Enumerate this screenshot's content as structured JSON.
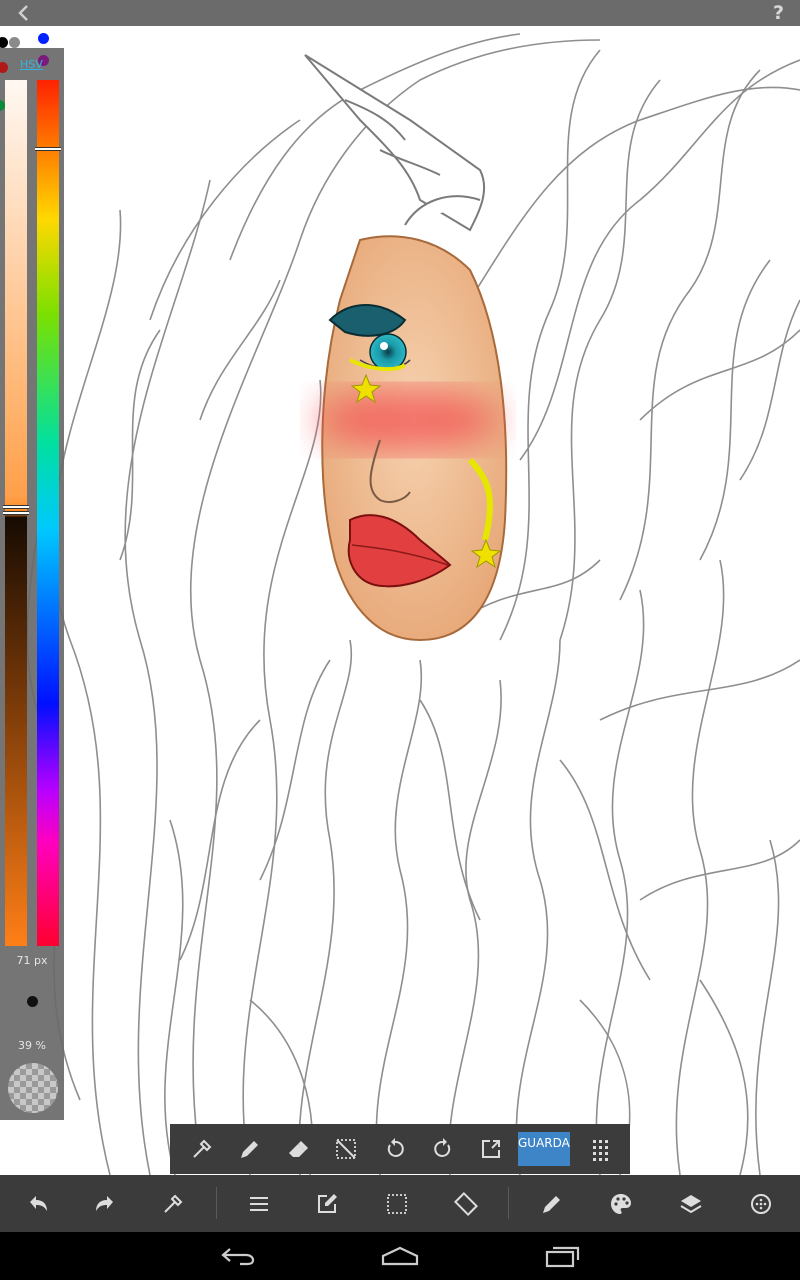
{
  "app": {
    "back_icon": "chevron-left-icon",
    "help_label": "?"
  },
  "color_panel": {
    "mode_label": "HSV",
    "recent_colors": [
      "#000000",
      "#8a8a8a",
      "#0022ff",
      "#b01818",
      "#7a1a7a",
      "#0a8a3a"
    ],
    "current_color": "#ff7f17",
    "brush_size_label": "71 px",
    "opacity_label": "39 %",
    "opacity_value": 0.39
  },
  "sub_toolbar": {
    "icons": [
      "eyedropper-icon",
      "pencil-icon",
      "eraser-icon",
      "deselect-icon",
      "rotate-left-icon",
      "rotate-right-icon",
      "export-icon"
    ],
    "save_label": "GUARDAR",
    "more_icon": "grid-dots-icon"
  },
  "toolbar": {
    "icons": [
      "undo-icon",
      "redo-icon",
      "eyedropper-icon",
      "menu-icon",
      "edit-icon",
      "selection-icon",
      "transform-icon",
      "brush-icon",
      "palette-icon",
      "layers-icon",
      "more-circle-icon"
    ]
  },
  "navbar": {
    "icons": [
      "nav-back-icon",
      "nav-home-icon",
      "nav-recents-icon"
    ]
  }
}
